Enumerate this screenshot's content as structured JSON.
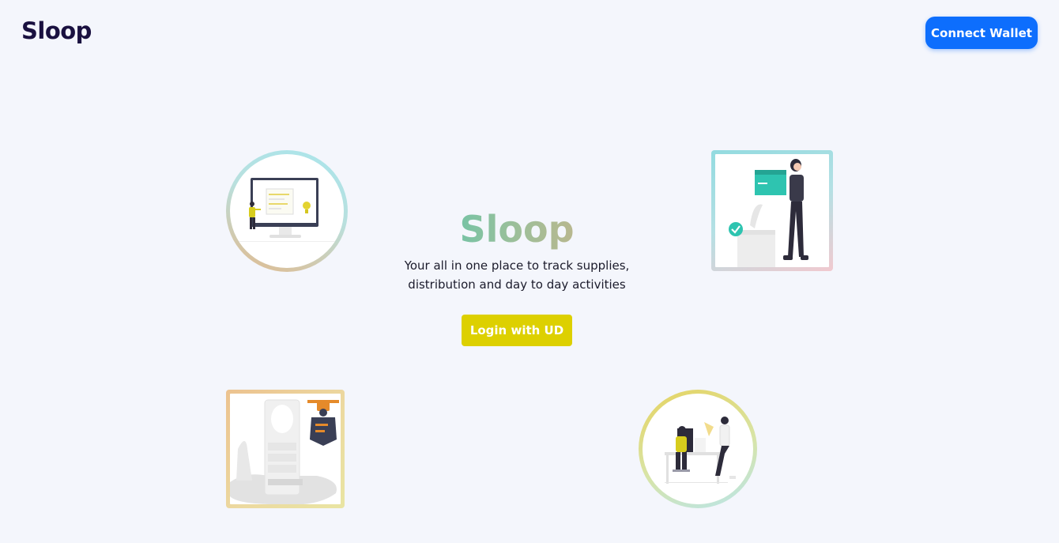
{
  "header": {
    "brand": "Sloop",
    "connect_label": "Connect Wallet"
  },
  "hero": {
    "title": "Sloop",
    "subtitle_line1": "Your all in one place to track supplies,",
    "subtitle_line2": "distribution and day to day activities",
    "login_label": "Login with UD"
  },
  "colors": {
    "background": "#f4f6fc",
    "brand_text": "#1a1140",
    "connect_button": "#0d6efd",
    "login_button": "#ddd000",
    "title_gradient_start": "#3fc9b4",
    "title_gradient_end": "#e2ac7d"
  },
  "illustrations": [
    {
      "name": "person-at-monitor-illustration",
      "frame": "circle"
    },
    {
      "name": "woman-carrying-box-illustration",
      "frame": "square"
    },
    {
      "name": "drone-delivery-illustration",
      "frame": "square"
    },
    {
      "name": "team-at-desk-illustration",
      "frame": "circle"
    }
  ]
}
